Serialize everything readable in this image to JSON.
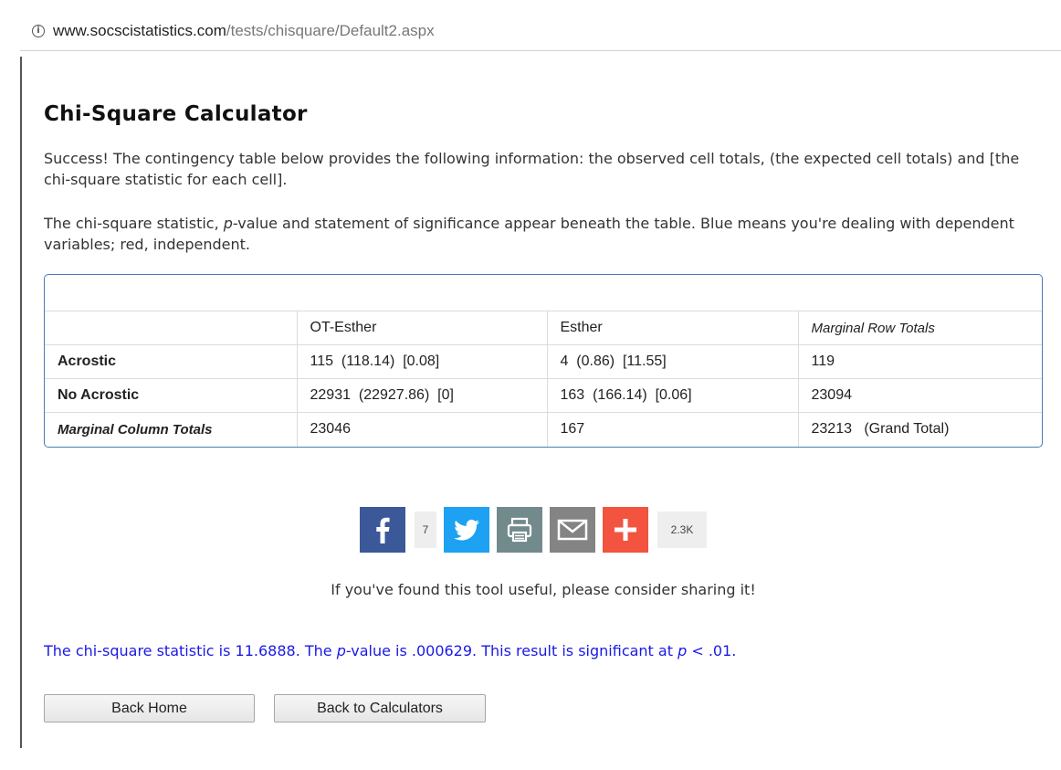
{
  "browser": {
    "url_host": "www.socscistatistics.com",
    "url_path": "/tests/chisquare/Default2.aspx"
  },
  "page": {
    "title": "Chi-Square Calculator",
    "intro1": "Success! The contingency table below provides the following information: the observed cell totals, (the expected cell totals) and [the chi-square statistic for each cell].",
    "intro2_a": "The chi-square statistic, ",
    "intro2_p": "p",
    "intro2_b": "-value and statement of significance appear beneath the table. Blue means you're dealing with dependent variables; red, independent."
  },
  "table": {
    "headers": [
      "",
      "OT-Esther",
      "Esther",
      "Marginal Row Totals"
    ],
    "rows": [
      [
        "Acrostic",
        "115  (118.14)  [0.08]",
        "4  (0.86)  [11.55]",
        "119"
      ],
      [
        "No Acrostic",
        "22931  (22927.86)  [0]",
        "163  (166.14)  [0.06]",
        "23094"
      ],
      [
        "Marginal Column Totals",
        "23046",
        "167",
        "23213   (Grand Total)"
      ]
    ]
  },
  "share": {
    "facebook_count": "7",
    "total_count": "2.3K",
    "message": "If you've found this tool useful, please consider sharing it!",
    "colors": {
      "facebook": "#3b5998",
      "twitter": "#1da1f2",
      "print": "#738a8d",
      "email": "#848484",
      "more": "#f2543f"
    }
  },
  "result": {
    "part1": "The chi-square statistic is 11.6888. The ",
    "p1": "p",
    "part2": "-value is .000629. This result is significant at ",
    "p2": "p",
    "part3": " < .01."
  },
  "buttons": {
    "back_home": "Back Home",
    "back_calculators": "Back to Calculators"
  }
}
